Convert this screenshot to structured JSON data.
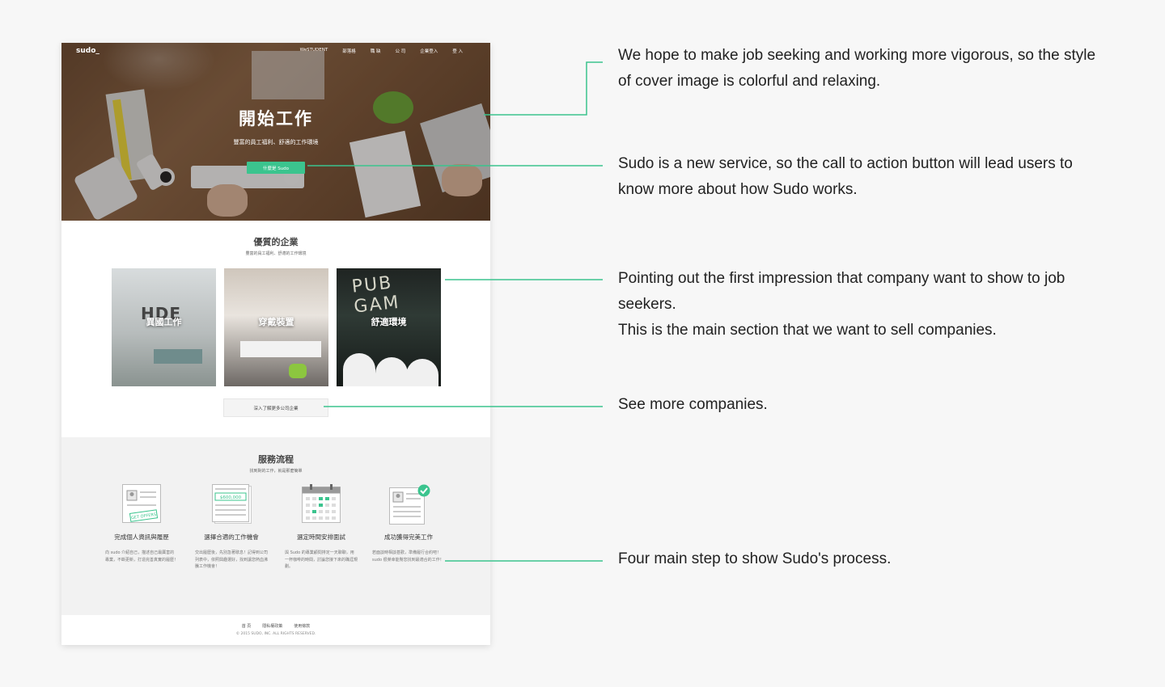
{
  "nav": {
    "logo": "sudo_",
    "items": [
      "WeSTUDENT",
      "部落格",
      "職 缺",
      "公 司",
      "企業登入",
      "登 入"
    ]
  },
  "hero": {
    "title": "開始工作",
    "subtitle": "豐富的員工福利、舒適的工作環境",
    "cta": "什麼是 Sudo"
  },
  "companies": {
    "title": "優質的企業",
    "subtitle": "豐富的員工福利、舒適的工作環境",
    "cards": [
      {
        "caption": "異國工作",
        "wall_text": "HDE"
      },
      {
        "caption": "穿戴裝置"
      },
      {
        "caption": "舒適環境",
        "wall_text": "PUB GAM"
      }
    ],
    "more_button": "深入了解更多公司企業"
  },
  "process": {
    "title": "服務流程",
    "subtitle": "找到對的工作，就是那麼簡單",
    "steps": [
      {
        "title": "完成個人資訊與履歷",
        "desc": "向 sudo 介紹自己，描述自己最厲害的專業，不斷更新，打造完善真實的履歷！",
        "icon": "resume-icon",
        "badge": "GET OFFERS"
      },
      {
        "title": "選擇合適的工作機會",
        "desc": "交出履歷後，先別急著歇息！記得到公司列表中，依照興趣選好，找到讓您熱血沸騰工作機會！",
        "icon": "offer-document-icon",
        "badge": "$600,000"
      },
      {
        "title": "選定時間安排面試",
        "desc": "與 Sudo 的專業顧問排定一天聊聊，用一杯咖啡的時間，討論您接下來的職涯規劃。",
        "icon": "calendar-icon"
      },
      {
        "title": "成功獲得完美工作",
        "desc": "若面談時相談甚歡，準備履行合約吧！ sudo 很榮幸能幫您找到最適合的工作！",
        "icon": "approved-resume-icon"
      }
    ]
  },
  "footer": {
    "links": [
      "首 頁",
      "隱私權政策",
      "使用條款"
    ],
    "copyright": "© 2015 SUDO, INC. ALL RIGHTS RESERVED."
  },
  "annotations": [
    "We hope to make job seeking and working more vigorous, so the style of cover image is colorful and relaxing.",
    "Sudo is a new service, so the call to action button will lead users to know more about how Sudo works.",
    "Pointing out the first impression that company want to show to job seekers.",
    "This is the main section that we want to sell companies.",
    "See more companies.",
    "Four main step to show Sudo's process."
  ],
  "colors": {
    "accent": "#3bc48e",
    "page_bg": "#f7f7f7"
  }
}
